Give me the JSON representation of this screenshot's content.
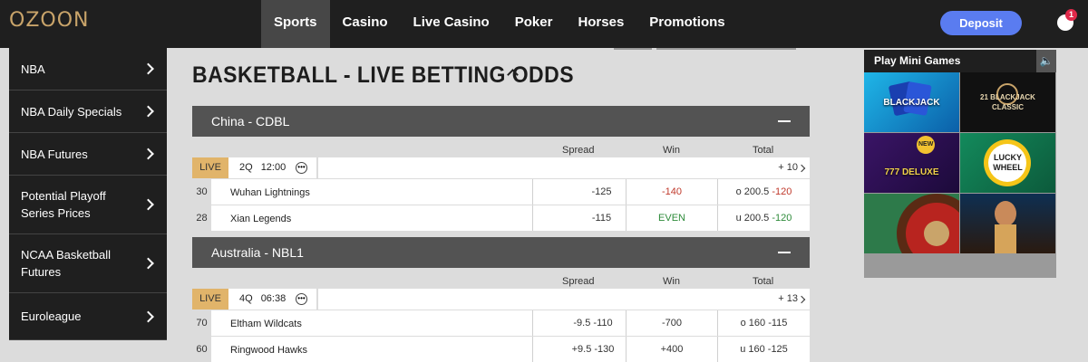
{
  "header": {
    "logo": "OZOON",
    "nav": [
      {
        "label": "Sports",
        "active": true
      },
      {
        "label": "Casino"
      },
      {
        "label": "Live Casino"
      },
      {
        "label": "Poker"
      },
      {
        "label": "Horses"
      },
      {
        "label": "Promotions"
      }
    ],
    "deposit_label": "Deposit",
    "notification_count": "1"
  },
  "sidebar": {
    "items": [
      {
        "label": "NBA"
      },
      {
        "label": "NBA Daily Specials"
      },
      {
        "label": "NBA Futures"
      },
      {
        "label": "Potential Playoff Series Prices"
      },
      {
        "label": "NCAA Basketball Futures"
      },
      {
        "label": "Euroleague"
      }
    ]
  },
  "main": {
    "title": "BASKETBALL - LIVE BETTING ODDS",
    "columns": {
      "spread": "Spread",
      "win": "Win",
      "total": "Total"
    },
    "leagues": [
      {
        "name": "China - CDBL",
        "game": {
          "status": "LIVE",
          "period": "2Q",
          "clock": "12:00",
          "more": "+ 10",
          "teams": [
            {
              "rot": "30",
              "name": "Wuhan Lightnings",
              "spread_line": "",
              "spread_odds": "-125",
              "win": "-140",
              "total_line": "o 200.5",
              "total_odds": "-120"
            },
            {
              "rot": "28",
              "name": "Xian Legends",
              "spread_line": "",
              "spread_odds": "-115",
              "win": "EVEN",
              "total_line": "u 200.5",
              "total_odds": "-120"
            }
          ]
        }
      },
      {
        "name": "Australia - NBL1",
        "game": {
          "status": "LIVE",
          "period": "4Q",
          "clock": "06:38",
          "more": "+ 13",
          "teams": [
            {
              "rot": "70",
              "name": "Eltham Wildcats",
              "spread_line": "-9.5",
              "spread_odds": "-110",
              "win": "-700",
              "total_line": "o 160",
              "total_odds": "-115"
            },
            {
              "rot": "60",
              "name": "Ringwood Hawks",
              "spread_line": "+9.5",
              "spread_odds": "-130",
              "win": "+400",
              "total_line": "u 160",
              "total_odds": "-125"
            }
          ]
        }
      }
    ]
  },
  "minigames": {
    "title": "Play Mini Games",
    "tiles": [
      {
        "label": "BLACKJACK",
        "icon": "blackjack-cards-icon"
      },
      {
        "label": "21 BLACKJACK CLASSIC",
        "icon": "blackjack-classic-icon"
      },
      {
        "label": "777 DELUXE",
        "badge": "NEW",
        "icon": "slots-777-icon"
      },
      {
        "label": "LUCKY WHEEL",
        "icon": "lucky-wheel-icon"
      },
      {
        "label": "",
        "icon": "roulette-wheel-icon"
      },
      {
        "label": "",
        "icon": "egyptian-queen-icon"
      }
    ]
  },
  "colors": {
    "accent": "#5a7cf0",
    "live": "#e1b46a",
    "dark": "#1f1f1f",
    "negative": "#c0392b",
    "positive": "#2e8b3a"
  }
}
